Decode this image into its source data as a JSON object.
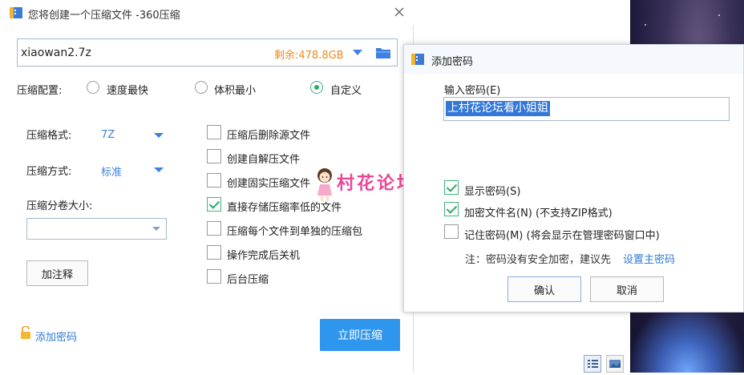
{
  "compress_window": {
    "title": "您将创建一个压缩文件 -360压缩",
    "path_value": "xiaowan2.7z",
    "free_space": "剩余:478.8GB",
    "config_label": "压缩配置:",
    "config_options": [
      {
        "label": "速度最快",
        "selected": false
      },
      {
        "label": "体积最小",
        "selected": false
      },
      {
        "label": "自定义",
        "selected": true
      }
    ],
    "format_label": "压缩格式:",
    "format_value": "7Z",
    "method_label": "压缩方式:",
    "method_value": "标准",
    "volume_label": "压缩分卷大小:",
    "volume_value": "",
    "comment_button": "加注释",
    "options": [
      {
        "label": "压缩后删除源文件",
        "checked": false
      },
      {
        "label": "创建自解压文件",
        "checked": false
      },
      {
        "label": "创建固实压缩文件",
        "checked": false
      },
      {
        "label": "直接存储压缩率低的文件",
        "checked": true
      },
      {
        "label": "压缩每个文件到单独的压缩包",
        "checked": false
      },
      {
        "label": "操作完成后关机",
        "checked": false
      },
      {
        "label": "后台压缩",
        "checked": false
      }
    ],
    "add_password_link": "添加密码",
    "compress_button": "立即压缩"
  },
  "password_dialog": {
    "title": "添加密码",
    "input_label": "输入密码(E)",
    "input_value": "上村花论坛看小姐姐",
    "options": [
      {
        "label": "显示密码(S)",
        "checked": true
      },
      {
        "label": "加密文件名(N) (不支持ZIP格式)",
        "checked": true
      },
      {
        "label": "记住密码(M) (将会显示在管理密码窗口中)",
        "checked": false
      }
    ],
    "note_prefix": "注：密码没有安全加密，建议先",
    "note_link": "设置主密码",
    "ok_button": "确认",
    "cancel_button": "取消"
  },
  "watermark": {
    "text": "村花论坛"
  },
  "colors": {
    "accent_blue": "#2f96ee",
    "link_blue": "#2f7ad8",
    "check_green": "#2fa86a",
    "free_space_orange": "#f08a1c",
    "watermark_pink": "#e9479a",
    "selection_blue": "#3378d8"
  },
  "icons": {
    "app": "360zip-icon",
    "close": "close-icon",
    "folder": "folder-icon",
    "lock": "lock-icon"
  }
}
